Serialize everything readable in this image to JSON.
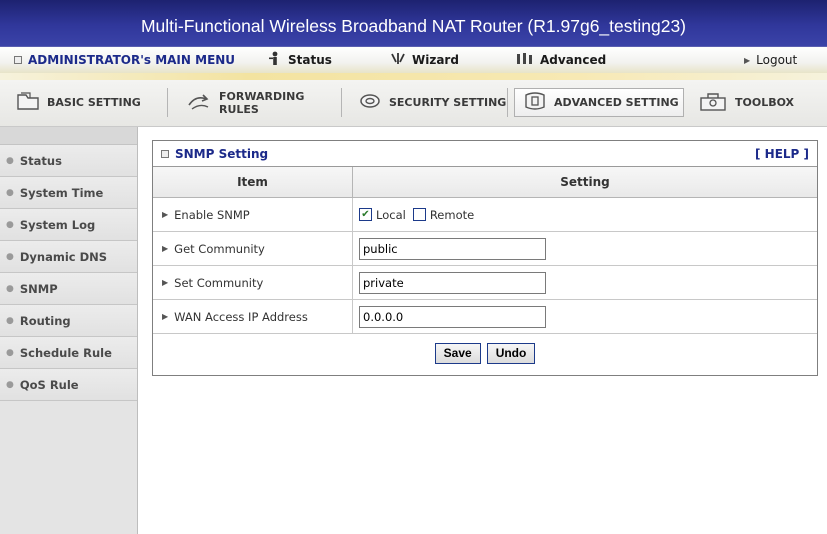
{
  "title": "Multi-Functional Wireless Broadband NAT Router (R1.97g6_testing23)",
  "menu": {
    "admin": "ADMINISTRATOR's MAIN MENU",
    "status": "Status",
    "wizard": "Wizard",
    "advanced": "Advanced",
    "logout": "Logout"
  },
  "tabs": [
    {
      "label": "BASIC SETTING",
      "icon": "folder-icon"
    },
    {
      "label": "FORWARDING RULES",
      "icon": "arrows-icon"
    },
    {
      "label": "SECURITY SETTING",
      "icon": "shield-icon"
    },
    {
      "label": "ADVANCED SETTING",
      "icon": "advanced-icon"
    },
    {
      "label": "TOOLBOX",
      "icon": "toolbox-icon"
    }
  ],
  "active_tab": "ADVANCED SETTING",
  "sidebar": {
    "items": [
      {
        "label": "Status"
      },
      {
        "label": "System Time"
      },
      {
        "label": "System Log"
      },
      {
        "label": "Dynamic DNS"
      },
      {
        "label": "SNMP"
      },
      {
        "label": "Routing"
      },
      {
        "label": "Schedule Rule"
      },
      {
        "label": "QoS Rule"
      }
    ]
  },
  "panel": {
    "title": "SNMP Setting",
    "help": "[ HELP ]",
    "col_item": "Item",
    "col_setting": "Setting",
    "rows": {
      "enable_snmp": {
        "label": "Enable SNMP",
        "local_label": "Local",
        "local_checked": true,
        "remote_label": "Remote",
        "remote_checked": false
      },
      "get_community": {
        "label": "Get Community",
        "value": "public"
      },
      "set_community": {
        "label": "Set Community",
        "value": "private"
      },
      "wan_access": {
        "label": "WAN Access IP Address",
        "value": "0.0.0.0"
      }
    },
    "save_label": "Save",
    "undo_label": "Undo"
  },
  "colors": {
    "title_bg": "#30379b",
    "accent": "#1c2a8a"
  }
}
